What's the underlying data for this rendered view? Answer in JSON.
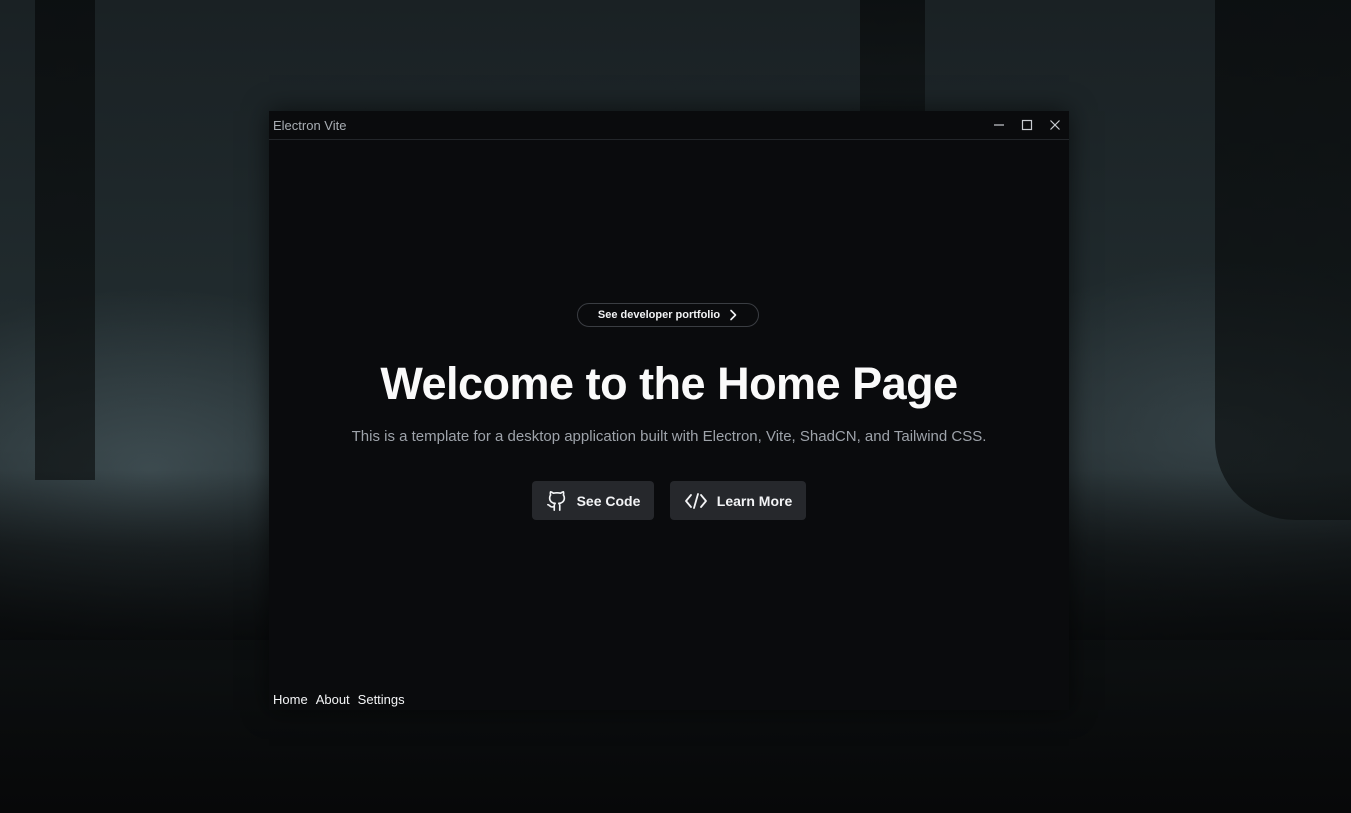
{
  "window": {
    "title": "Electron Vite",
    "controls": {
      "minimize_icon": "minimize-icon",
      "maximize_icon": "maximize-icon",
      "close_icon": "close-icon"
    }
  },
  "hero": {
    "pill_label": "See developer portfolio",
    "pill_icon": "chevron-right-icon",
    "heading": "Welcome to the Home Page",
    "subtitle": "This is a template for a desktop application built with Electron, Vite, ShadCN, and Tailwind CSS.",
    "buttons": [
      {
        "label": "See Code",
        "icon": "github-icon"
      },
      {
        "label": "Learn More",
        "icon": "code-icon"
      }
    ]
  },
  "nav": {
    "items": [
      {
        "label": "Home"
      },
      {
        "label": "About"
      },
      {
        "label": "Settings"
      }
    ]
  },
  "colors": {
    "window_bg": "#0a0b0d",
    "button_bg": "#26282c",
    "text_primary": "#fafafa",
    "text_muted": "#9ea3aa"
  }
}
